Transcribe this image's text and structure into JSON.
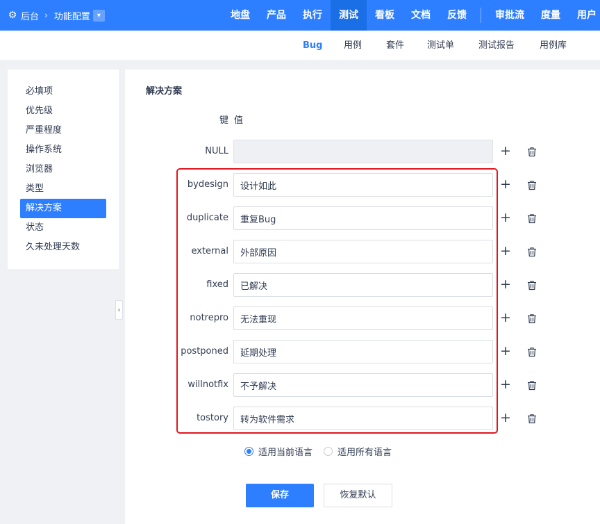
{
  "topbar": {
    "crumb_root": "后台",
    "crumb_current": "功能配置",
    "nav": [
      {
        "label": "地盘",
        "name": "nav-dashboard"
      },
      {
        "label": "产品",
        "name": "nav-product"
      },
      {
        "label": "执行",
        "name": "nav-execution"
      },
      {
        "label": "测试",
        "name": "nav-qa"
      },
      {
        "label": "看板",
        "name": "nav-kanban"
      },
      {
        "label": "文档",
        "name": "nav-doc"
      },
      {
        "label": "反馈",
        "name": "nav-feedback"
      },
      {
        "label": "审批流",
        "name": "nav-approval"
      },
      {
        "label": "度量",
        "name": "nav-metrics"
      },
      {
        "label": "用户",
        "name": "nav-user"
      }
    ],
    "active_nav": "测试"
  },
  "subnav": {
    "items": [
      "Bug",
      "用例",
      "套件",
      "测试单",
      "测试报告",
      "用例库"
    ],
    "active": "Bug"
  },
  "sidebar": {
    "items": [
      "必填项",
      "优先级",
      "严重程度",
      "操作系统",
      "浏览器",
      "类型",
      "解决方案",
      "状态",
      "久未处理天数"
    ],
    "active": "解决方案"
  },
  "main": {
    "section_title": "解决方案",
    "key_header": "键",
    "value_header": "值",
    "rows": [
      {
        "key": "NULL",
        "value": "",
        "disabled": true
      },
      {
        "key": "bydesign",
        "value": "设计如此"
      },
      {
        "key": "duplicate",
        "value": "重复Bug"
      },
      {
        "key": "external",
        "value": "外部原因"
      },
      {
        "key": "fixed",
        "value": "已解决"
      },
      {
        "key": "notrepro",
        "value": "无法重现"
      },
      {
        "key": "postponed",
        "value": "延期处理"
      },
      {
        "key": "willnotfix",
        "value": "不予解决"
      },
      {
        "key": "tostory",
        "value": "转为软件需求"
      }
    ],
    "lang_options": [
      {
        "label": "适用当前语言",
        "checked": true
      },
      {
        "label": "适用所有语言",
        "checked": false
      }
    ],
    "save_label": "保存",
    "reset_label": "恢复默认"
  },
  "colors": {
    "primary": "#2e7fff",
    "highlight": "#e0141e"
  }
}
